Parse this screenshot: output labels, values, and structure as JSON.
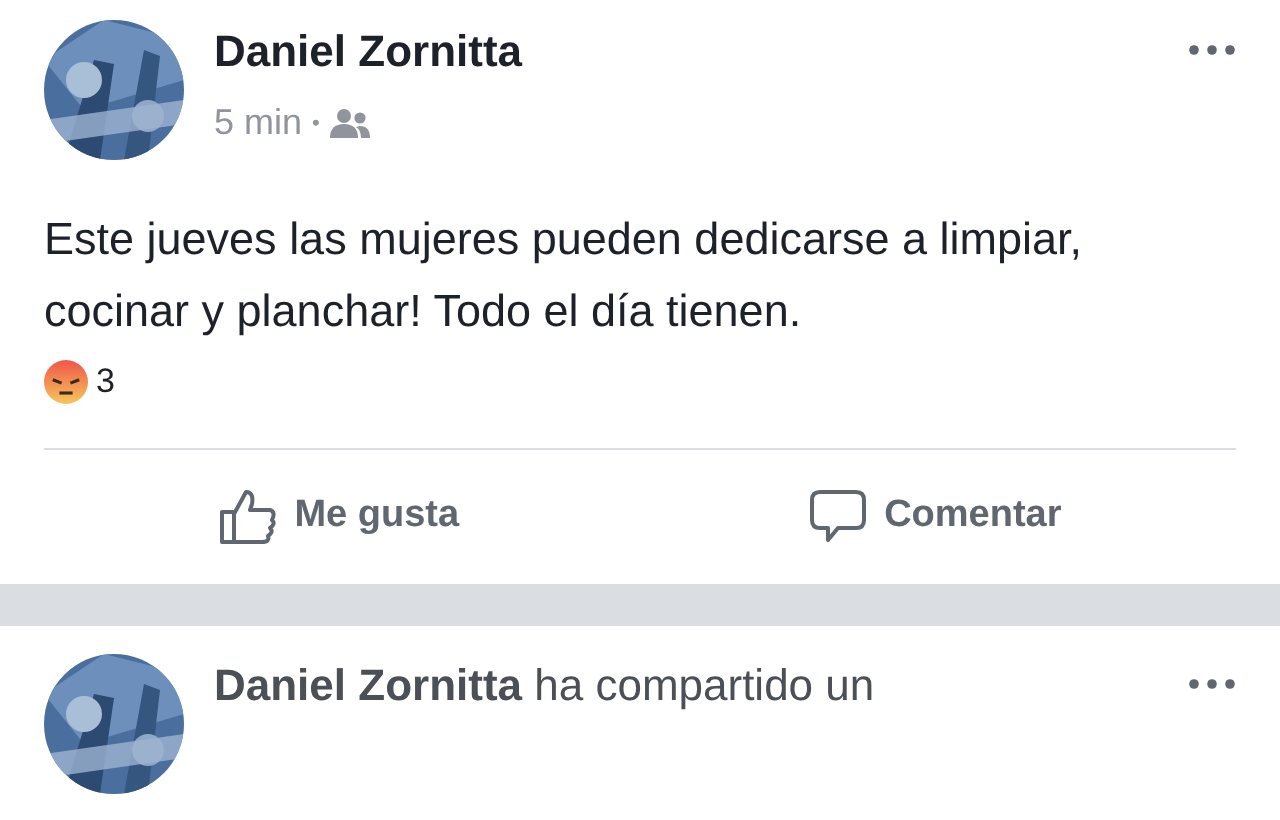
{
  "posts": [
    {
      "author": "Daniel Zornitta",
      "time": "5 min",
      "separator": "•",
      "audience": {
        "kind": "friends"
      },
      "text": "Este jueves las mujeres pueden dedicarse a limpiar, cocinar y planchar! Todo el día tienen.",
      "reactions": {
        "kind": "angry",
        "count": "3"
      },
      "actions": [
        {
          "kind": "like",
          "label": "Me gusta"
        },
        {
          "kind": "comment",
          "label": "Comentar"
        }
      ]
    },
    {
      "headline": "**Daniel Zornitta** ha compartido un"
    }
  ]
}
